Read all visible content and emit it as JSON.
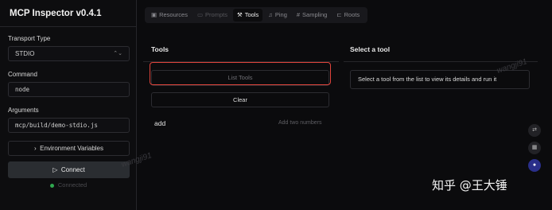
{
  "app": {
    "title": "MCP Inspector v0.4.1"
  },
  "sidebar": {
    "transport_label": "Transport Type",
    "transport_value": "STDIO",
    "command_label": "Command",
    "command_value": "node",
    "arguments_label": "Arguments",
    "arguments_value": "mcp/build/demo-stdio.js",
    "env_button": "Environment Variables",
    "connect_button": "Connect",
    "status": "Connected"
  },
  "tabs": [
    {
      "label": "Resources",
      "icon": "resources-icon"
    },
    {
      "label": "Prompts",
      "icon": "message-icon"
    },
    {
      "label": "Tools",
      "icon": "hammer-icon"
    },
    {
      "label": "Ping",
      "icon": "bell-icon"
    },
    {
      "label": "Sampling",
      "icon": "hash-icon"
    },
    {
      "label": "Roots",
      "icon": "folder-tree-icon"
    }
  ],
  "tools_panel": {
    "title": "Tools",
    "list_button": "List Tools",
    "clear_button": "Clear",
    "items": [
      {
        "name": "add",
        "description": "Add two numbers"
      }
    ]
  },
  "detail_panel": {
    "title": "Select a tool",
    "hint": "Select a tool from the list to view its details and run it"
  },
  "watermarks": [
    "wangji91",
    "wangji91"
  ],
  "side_icons": [
    "translate-icon",
    "grid-icon",
    "assistant-icon"
  ],
  "credit": "知乎 @王大锤",
  "colors": {
    "highlight": "#e0443c",
    "status_dot": "#2fa84f"
  }
}
